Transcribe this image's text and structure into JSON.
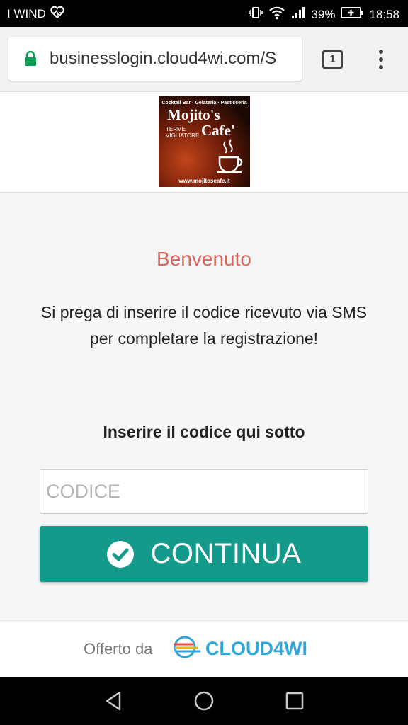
{
  "status_bar": {
    "carrier": "I WIND",
    "battery": "39%",
    "time": "18:58"
  },
  "browser": {
    "url": "businesslogin.cloud4wi.com/S",
    "tab_count": "1"
  },
  "logo": {
    "subtitle": "Cocktail Bar · Gelateria · Pasticceria",
    "name_line1": "Mojito's",
    "name_line2": "Cafe'",
    "location": "TERME VIGLIATORE",
    "website": "www.mojitoscafe.it"
  },
  "main": {
    "welcome": "Benvenuto",
    "message": "Si prega di inserire il codice ricevuto via SMS per completare la registrazione!",
    "code_label": "Inserire il codice qui sotto",
    "code_placeholder": "CODICE",
    "continue_label": "CONTINUA"
  },
  "footer": {
    "offered_by": "Offerto da",
    "brand": "CLOUD4WI"
  },
  "colors": {
    "accent": "#139a8a",
    "welcome": "#d9675f",
    "brand": "#2fa6d8"
  }
}
